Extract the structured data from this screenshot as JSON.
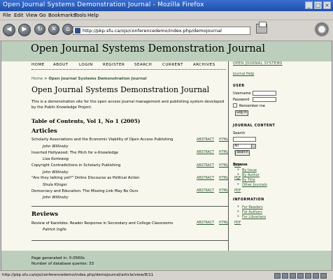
{
  "window": {
    "title": "Open Journal Systems Demonstration Journal - Mozilla Firefox"
  },
  "menu": [
    "File",
    "Edit",
    "View",
    "Go",
    "Bookmarks",
    "Tools",
    "Help"
  ],
  "address": {
    "url": "http://pkp.sfu.ca/ojs/conferencedemo/index.php/demojournal"
  },
  "site": {
    "title": "Open Journal Systems Demonstration Journal"
  },
  "topnav": [
    "HOME",
    "ABOUT",
    "LOGIN",
    "REGISTER",
    "SEARCH",
    "CURRENT",
    "ARCHIVES"
  ],
  "breadcrumb": {
    "home": "Home",
    "sep": ">",
    "current": "Open Journal Systems Demonstration Journal"
  },
  "page": {
    "title": "Open Journal Systems Demonstration Journal",
    "intro": "This is a demonstration site for the open access journal management and publishing system developed by the Public Knowledge Project.",
    "toc_title": "Table of Contents, Vol 1, No 1 (2005)"
  },
  "sections": [
    {
      "name": "Articles",
      "articles": [
        {
          "title": "Scholarly Associations and the Economic Viability of Open Access Publishing",
          "author": "John Willinsky"
        },
        {
          "title": "Inverted Hollywood: The Pitch for e-Knowledge",
          "author": "Lisa Korteweg"
        },
        {
          "title": "Copyright Contradictions in Scholarly Publishing",
          "author": "John Willinsky"
        },
        {
          "title": "\"Are they talking yet?\" Online Discourse as Political Action",
          "author": "Shula Klinger"
        },
        {
          "title": "Democracy and Education: The Missing Link May Be Ours",
          "author": "John Willinsky"
        }
      ]
    },
    {
      "name": "Reviews",
      "articles": [
        {
          "title": "Review of Karolides. Reader Response in Secondary and College Classrooms",
          "author": "Patrick Inglis"
        }
      ]
    }
  ],
  "article_links": {
    "abstract": "ABSTRACT",
    "html": "HTML",
    "pdf": "PDF"
  },
  "sidebar": {
    "brand_link": "OPEN JOURNAL SYSTEMS",
    "help_link": "Journal Help",
    "user_heading": "USER",
    "username_label": "Username",
    "password_label": "Password",
    "remember_label": "Remember me",
    "login_button": "Log In",
    "content_heading": "JOURNAL CONTENT",
    "search_label": "Search",
    "search_scope": "All",
    "search_button": "Search",
    "browse_label": "Browse",
    "browse_items": [
      "By Issue",
      "By Author",
      "By Title",
      "Other Journals"
    ],
    "info_heading": "INFORMATION",
    "info_items": [
      "For Readers",
      "For Authors",
      "For Librarians"
    ]
  },
  "footer": {
    "generated": "Page generated in: 0.0560s",
    "queries": "Number of database queries: 33"
  },
  "status": {
    "text": "http://pkp.sfu.ca/ojs/conferencedemo/index.php/demojournal/article/view/8/11"
  }
}
